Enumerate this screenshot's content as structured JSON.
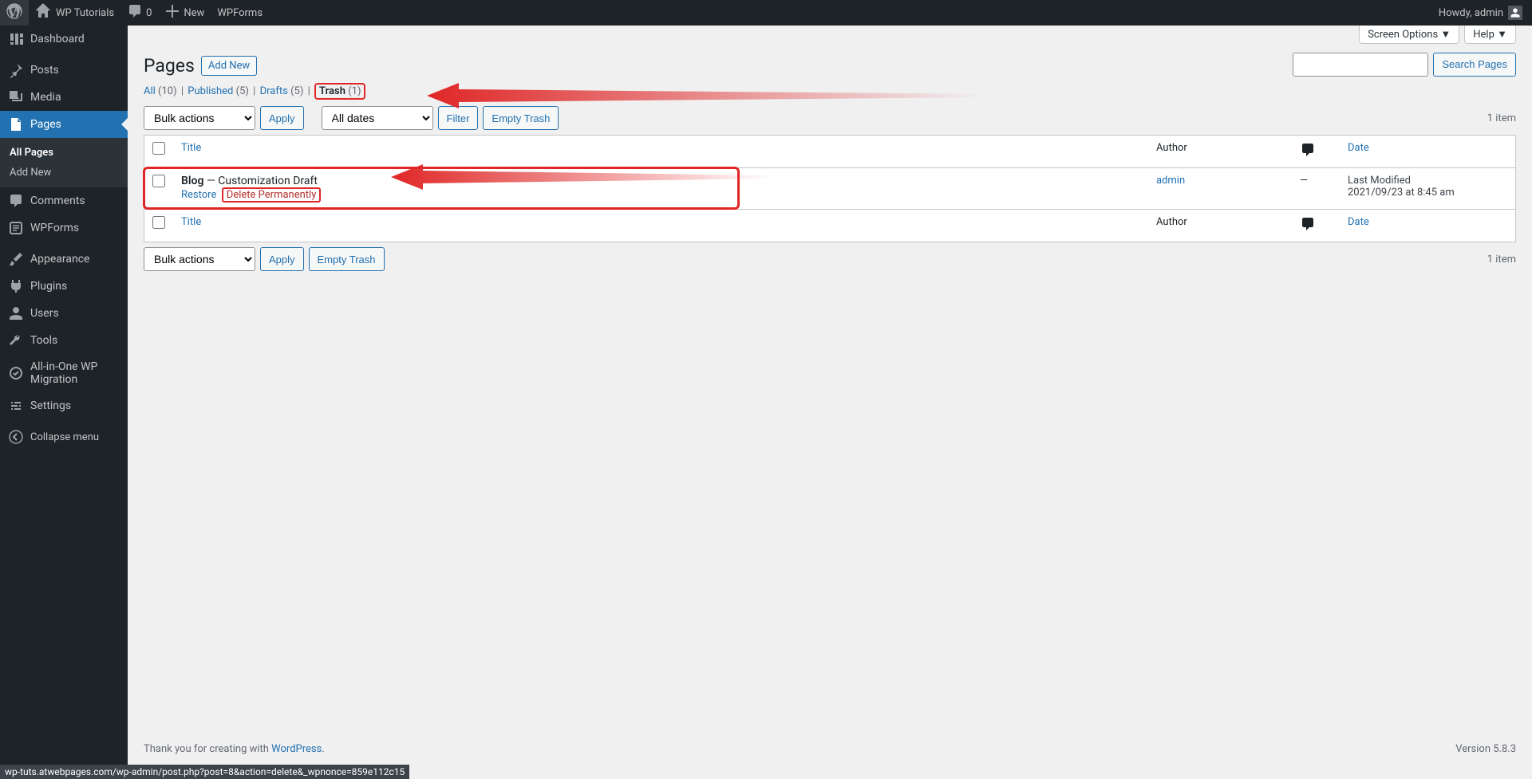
{
  "adminbar": {
    "site_name": "WP Tutorials",
    "comments_count": "0",
    "new_label": "New",
    "wpforms_label": "WPForms",
    "howdy": "Howdy, admin"
  },
  "sidebar": {
    "items": [
      {
        "label": "Dashboard",
        "icon": "dashboard"
      },
      {
        "label": "Posts",
        "icon": "pin"
      },
      {
        "label": "Media",
        "icon": "media"
      },
      {
        "label": "Pages",
        "icon": "page",
        "current": true
      },
      {
        "label": "Comments",
        "icon": "comment"
      },
      {
        "label": "WPForms",
        "icon": "wpforms"
      },
      {
        "label": "Appearance",
        "icon": "brush"
      },
      {
        "label": "Plugins",
        "icon": "plugin"
      },
      {
        "label": "Users",
        "icon": "user"
      },
      {
        "label": "Tools",
        "icon": "tools"
      },
      {
        "label": "All-in-One WP Migration",
        "icon": "migrate"
      },
      {
        "label": "Settings",
        "icon": "settings"
      }
    ],
    "submenu": [
      {
        "label": "All Pages",
        "active": true
      },
      {
        "label": "Add New",
        "active": false
      }
    ],
    "collapse_label": "Collapse menu"
  },
  "screen_meta": {
    "screen_options": "Screen Options ▼",
    "help": "Help ▼"
  },
  "heading": {
    "title": "Pages",
    "add_new": "Add New"
  },
  "filters": {
    "all_label": "All",
    "all_count": "(10)",
    "published_label": "Published",
    "published_count": "(5)",
    "drafts_label": "Drafts",
    "drafts_count": "(5)",
    "trash_label": "Trash",
    "trash_count": "(1)"
  },
  "search": {
    "button": "Search Pages"
  },
  "bulk": {
    "select_label": "Bulk actions",
    "apply": "Apply",
    "dates_label": "All dates",
    "filter": "Filter",
    "empty_trash": "Empty Trash"
  },
  "count_text": "1 item",
  "table": {
    "headers": {
      "title": "Title",
      "author": "Author",
      "date": "Date"
    },
    "rows": [
      {
        "title": "Blog",
        "state": "— Customization Draft",
        "restore": "Restore",
        "delete": "Delete Permanently",
        "author": "admin",
        "comments": "—",
        "date_label": "Last Modified",
        "date_value": "2021/09/23 at 8:45 am"
      }
    ]
  },
  "footer": {
    "thanks": "Thank you for creating with ",
    "wp": "WordPress",
    "period": ".",
    "version": "Version 5.8.3"
  },
  "status_url": "wp-tuts.atwebpages.com/wp-admin/post.php?post=8&action=delete&_wpnonce=859e112c15"
}
